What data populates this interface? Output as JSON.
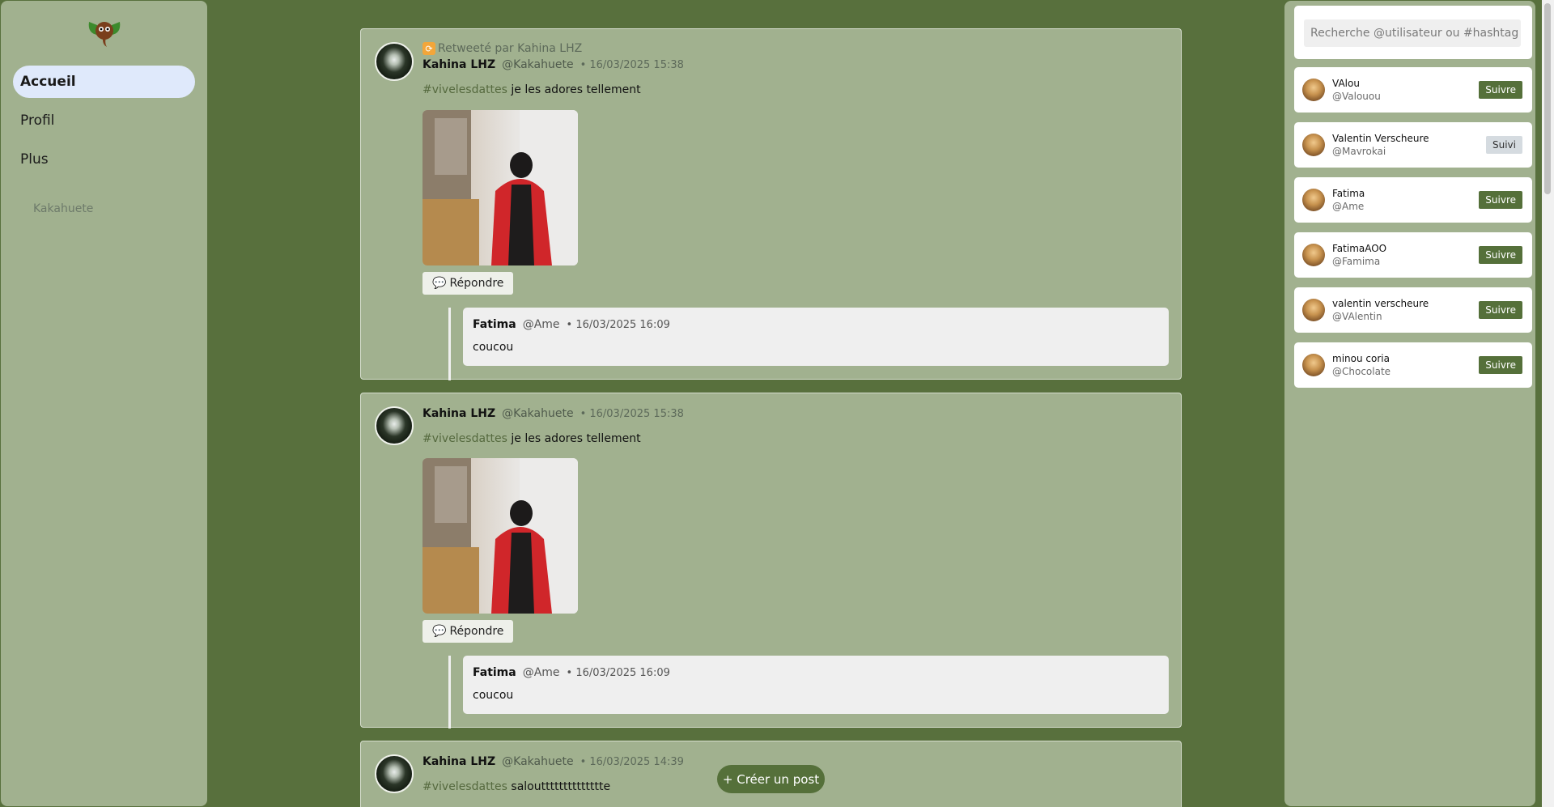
{
  "sidebar": {
    "items": [
      {
        "label": "Accueil"
      },
      {
        "label": "Profil"
      },
      {
        "label": "Plus"
      }
    ],
    "username": "Kakahuete"
  },
  "posts": [
    {
      "retweet": "Retweeté par Kahina LHZ",
      "name": "Kahina LHZ",
      "handle": "@Kakahuete",
      "date": "• 16/03/2025 15:38",
      "hashtag": "#vivelesdattes",
      "text": "je les adores tellement",
      "reply_label": "Répondre",
      "reply": {
        "name": "Fatima",
        "handle": "@Ame",
        "date": "• 16/03/2025 16:09",
        "text": "coucou"
      }
    },
    {
      "name": "Kahina LHZ",
      "handle": "@Kakahuete",
      "date": "• 16/03/2025 15:38",
      "hashtag": "#vivelesdattes",
      "text": "je les adores tellement",
      "reply_label": "Répondre",
      "reply": {
        "name": "Fatima",
        "handle": "@Ame",
        "date": "• 16/03/2025 16:09",
        "text": "coucou"
      }
    },
    {
      "name": "Kahina LHZ",
      "handle": "@Kakahuete",
      "date": "• 16/03/2025 14:39",
      "hashtag": "#vivelesdattes",
      "text": "saloutttttttttttttte"
    }
  ],
  "create_post": "+ Créer un post",
  "search": {
    "placeholder": "Recherche @utilisateur ou #hashtag"
  },
  "suggestions": [
    {
      "name": "VAlou",
      "handle": "@Valouou",
      "button": "Suivre"
    },
    {
      "name": "Valentin Verscheure",
      "handle": "@Mavrokai",
      "button": "Suivi"
    },
    {
      "name": "Fatima",
      "handle": "@Ame",
      "button": "Suivre"
    },
    {
      "name": "FatimaAOO",
      "handle": "@Famima",
      "button": "Suivre"
    },
    {
      "name": "valentin verscheure",
      "handle": "@VAlentin",
      "button": "Suivre"
    },
    {
      "name": "minou coria",
      "handle": "@Chocolate",
      "button": "Suivre"
    }
  ],
  "colors": {
    "background": "#58703d",
    "panel": "#a1b18f",
    "accent": "#55703a",
    "active_nav": "#dfe9fb"
  }
}
